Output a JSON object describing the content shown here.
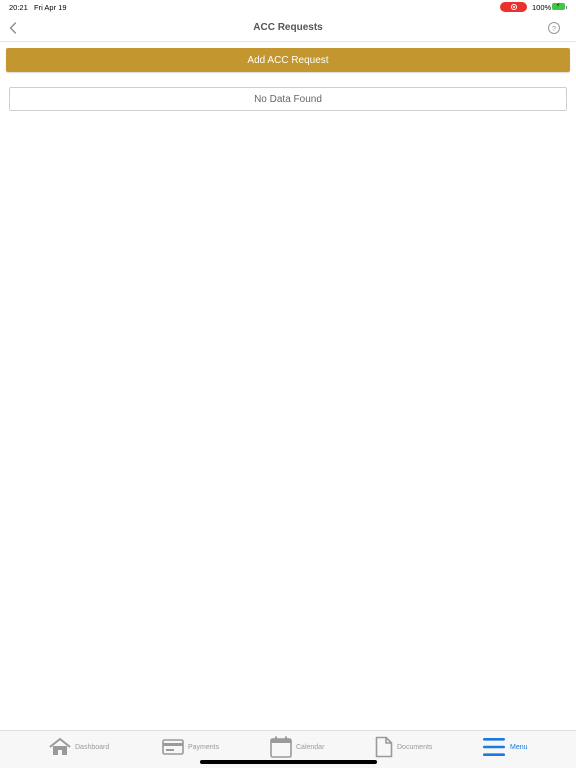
{
  "status_bar": {
    "time": "20:21",
    "date": "Fri Apr 19",
    "battery_percent": "100%",
    "recording_color": "#e8322d",
    "battery_color": "#3fc74a"
  },
  "nav": {
    "title": "ACC Requests",
    "back_icon": "chevron-left-icon",
    "help_icon": "question-circle-icon",
    "help_glyph": "?"
  },
  "main": {
    "add_button_label": "Add ACC Request",
    "add_button_color": "#c3962f",
    "empty_message": "No Data Found"
  },
  "tab_bar": {
    "active_color": "#1a7ae0",
    "inactive_color": "#9a9a9a",
    "tabs": [
      {
        "label": "Dashboard",
        "icon": "home-icon",
        "active": false
      },
      {
        "label": "Payments",
        "icon": "credit-card-icon",
        "active": false
      },
      {
        "label": "Calendar",
        "icon": "calendar-icon",
        "active": false
      },
      {
        "label": "Documents",
        "icon": "document-icon",
        "active": false
      },
      {
        "label": "Menu",
        "icon": "hamburger-menu-icon",
        "active": true
      }
    ]
  }
}
